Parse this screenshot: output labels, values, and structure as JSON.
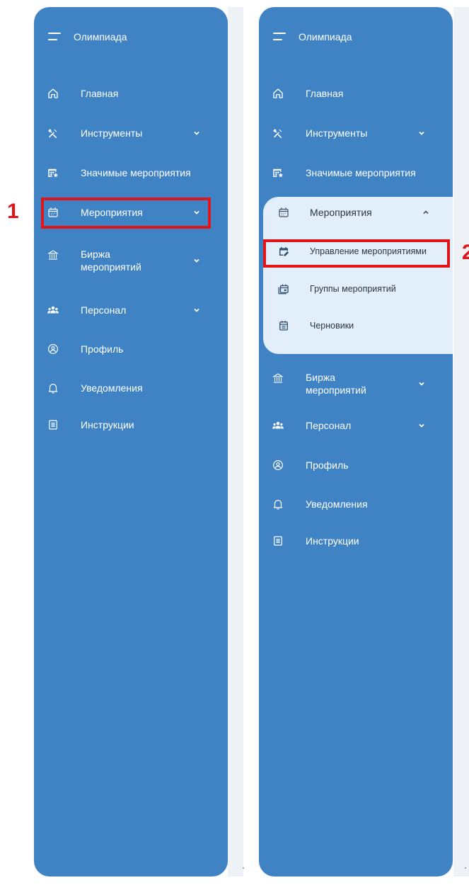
{
  "colors": {
    "sidebar_bg": "#3f83c5",
    "flyout_bg": "#e3eefb",
    "highlight": "#e0151a"
  },
  "step_labels": {
    "first": "1",
    "second": "2"
  },
  "panel_left": {
    "title": "Олимпиада",
    "items": [
      {
        "label": "Главная",
        "icon": "home-icon",
        "has_chevron": false
      },
      {
        "label": "Инструменты",
        "icon": "tools-icon",
        "has_chevron": true
      },
      {
        "label": "Значимые мероприятия",
        "icon": "featured-events-icon",
        "has_chevron": false
      },
      {
        "label": "Мероприятия",
        "icon": "calendar-icon",
        "has_chevron": true
      },
      {
        "label": "Биржа мероприятий",
        "icon": "exchange-icon",
        "has_chevron": true
      },
      {
        "label": "Персонал",
        "icon": "people-icon",
        "has_chevron": true
      },
      {
        "label": "Профиль",
        "icon": "profile-icon",
        "has_chevron": false
      },
      {
        "label": "Уведомления",
        "icon": "bell-icon",
        "has_chevron": false
      },
      {
        "label": "Инструкции",
        "icon": "document-icon",
        "has_chevron": false
      }
    ]
  },
  "panel_right": {
    "title": "Олимпиада",
    "items_before": [
      {
        "label": "Главная",
        "icon": "home-icon"
      },
      {
        "label": "Инструменты",
        "icon": "tools-icon"
      },
      {
        "label": "Значимые мероприятия",
        "icon": "featured-events-icon"
      }
    ],
    "expanded": {
      "label": "Мероприятия",
      "icon": "calendar-icon",
      "children": [
        {
          "label": "Управление мероприятиями",
          "icon": "calendar-edit-icon"
        },
        {
          "label": "Группы мероприятий",
          "icon": "calendar-group-icon"
        },
        {
          "label": "Черновики",
          "icon": "drafts-icon"
        }
      ]
    },
    "items_after": [
      {
        "label": "Биржа мероприятий",
        "icon": "exchange-icon"
      },
      {
        "label": "Персонал",
        "icon": "people-icon"
      },
      {
        "label": "Профиль",
        "icon": "profile-icon"
      },
      {
        "label": "Уведомления",
        "icon": "bell-icon"
      },
      {
        "label": "Инструкции",
        "icon": "document-icon"
      }
    ]
  }
}
